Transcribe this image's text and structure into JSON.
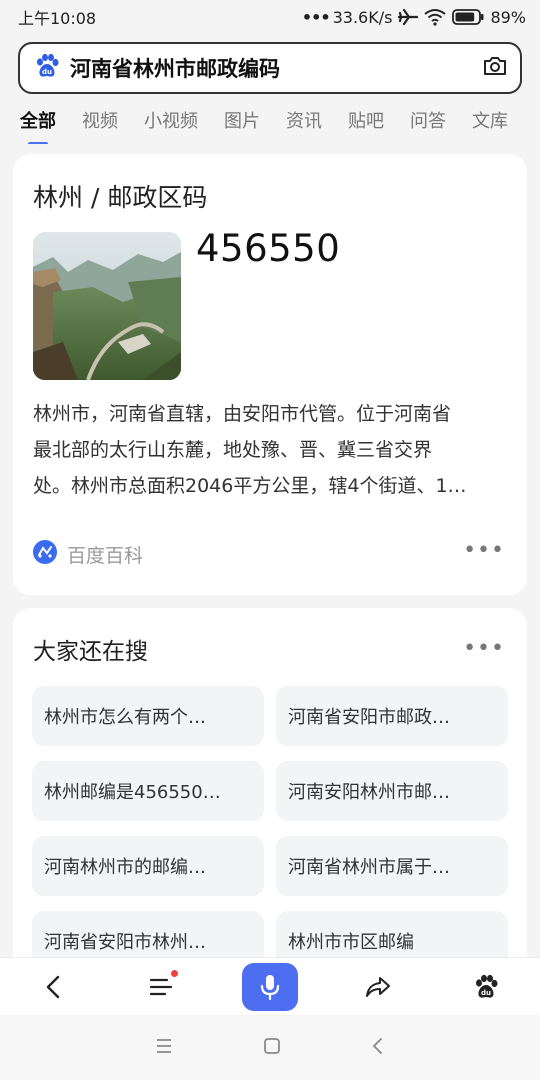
{
  "status_bar": {
    "time": "上午10:08",
    "network_speed": "33.6K/s",
    "battery": "89%",
    "battery_level": 0.89,
    "icons": [
      "signal-dots-icon",
      "airplane-icon",
      "wifi-icon",
      "battery-icon"
    ]
  },
  "search": {
    "query": "河南省林州市邮政编码",
    "left_icon": "baidu-paw-icon",
    "right_icon": "camera-icon"
  },
  "tabs": [
    {
      "label": "全部",
      "active": true
    },
    {
      "label": "视频"
    },
    {
      "label": "小视频"
    },
    {
      "label": "图片"
    },
    {
      "label": "资讯"
    },
    {
      "label": "贴吧"
    },
    {
      "label": "问答"
    },
    {
      "label": "文库"
    }
  ],
  "result": {
    "title": "林州 / 邮政区码",
    "postcode": "456550",
    "description_lines": [
      "林州市，河南省直辖，由安阳市代管。位于河南省",
      "最北部的太行山东麓，地处豫、晋、冀三省交界",
      "处。林州市总面积2046平方公里，辖4个街道、1…"
    ],
    "source": "百度百科",
    "source_icon": "baike-icon",
    "more_icon": "more-dots-icon"
  },
  "related": {
    "title": "大家还在搜",
    "items": [
      "林州市怎么有两个…",
      "河南省安阳市邮政…",
      "林州邮编是456550…",
      "河南安阳林州市邮…",
      "河南林州市的邮编…",
      "河南省林州市属于…",
      "河南省安阳市林州…",
      "林州市市区邮编"
    ]
  },
  "toolbar": {
    "icons": [
      "back-arrow-icon",
      "menu-icon",
      "mic-icon",
      "share-icon",
      "baidu-paw-icon"
    ],
    "accent": "#4e6ef2",
    "badge_color": "#f03e3e"
  },
  "system_nav": {
    "icons": [
      "recents-icon",
      "home-icon",
      "back-icon"
    ]
  }
}
